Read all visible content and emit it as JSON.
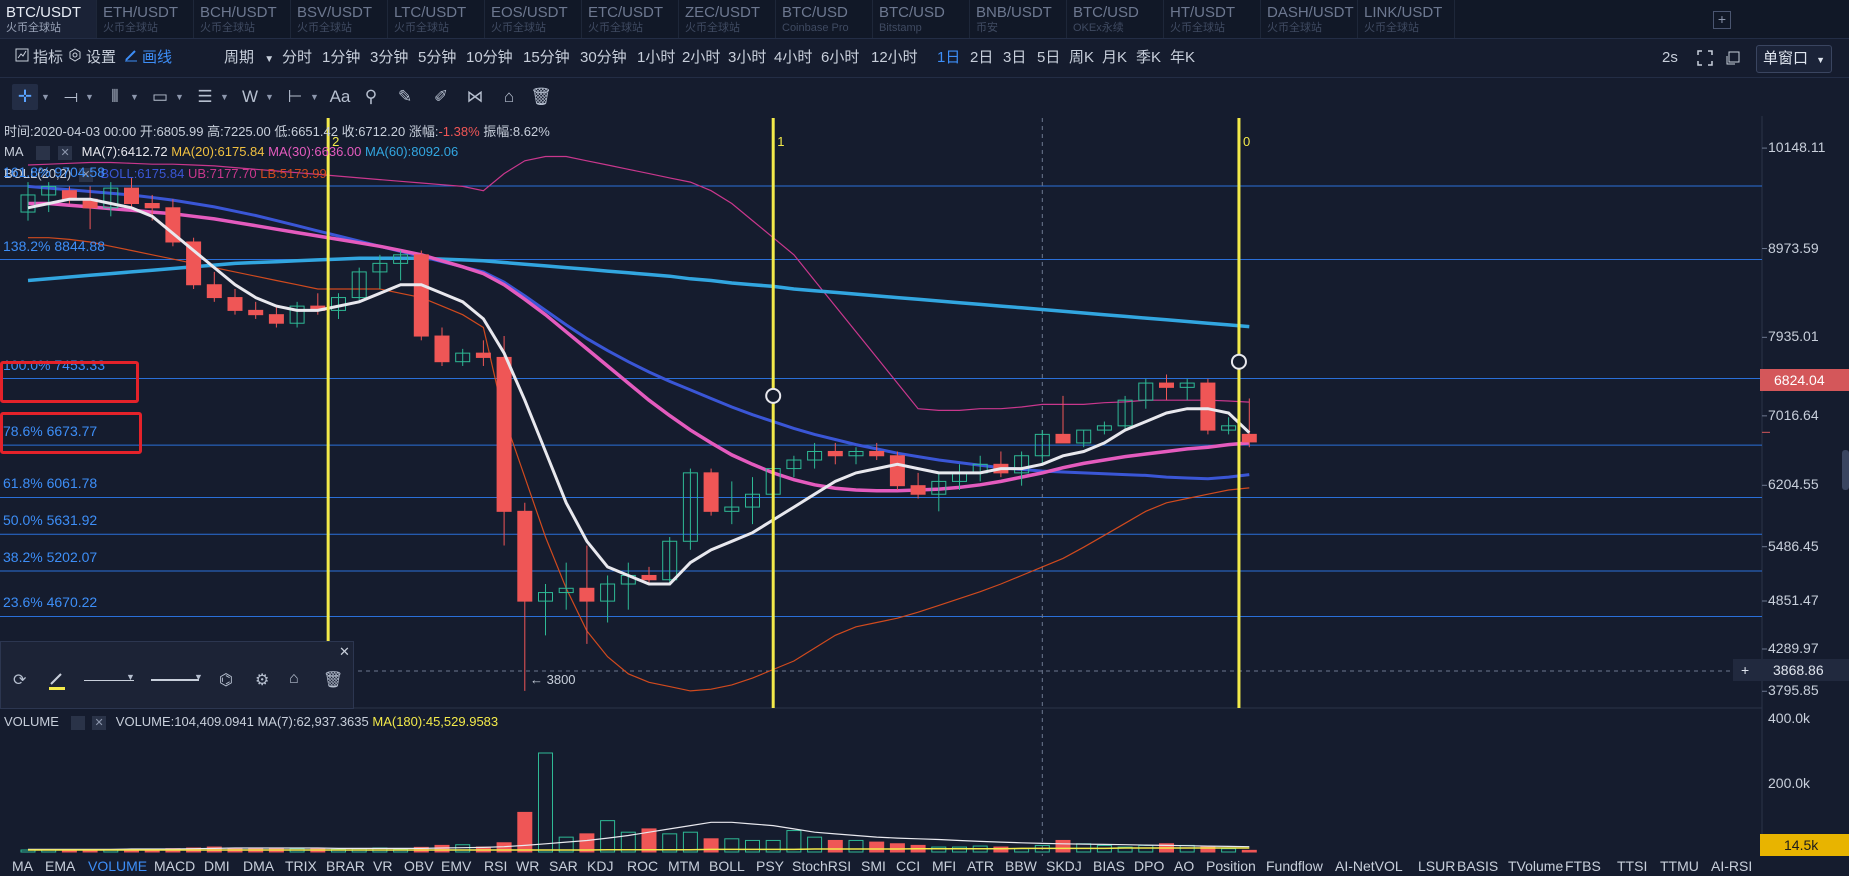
{
  "pair_tabs": [
    {
      "pair": "BTC/USDT",
      "source": "火币全球站"
    },
    {
      "pair": "ETH/USDT",
      "source": "火币全球站"
    },
    {
      "pair": "BCH/USDT",
      "source": "火币全球站"
    },
    {
      "pair": "BSV/USDT",
      "source": "火币全球站"
    },
    {
      "pair": "LTC/USDT",
      "source": "火币全球站"
    },
    {
      "pair": "EOS/USDT",
      "source": "火币全球站"
    },
    {
      "pair": "ETC/USDT",
      "source": "火币全球站"
    },
    {
      "pair": "ZEC/USDT",
      "source": "火币全球站"
    },
    {
      "pair": "BTC/USD",
      "source": "Coinbase Pro"
    },
    {
      "pair": "BTC/USD",
      "source": "Bitstamp"
    },
    {
      "pair": "BNB/USDT",
      "source": "币安"
    },
    {
      "pair": "BTC/USD",
      "source": "OKEx永续"
    },
    {
      "pair": "HT/USDT",
      "source": "火币全球站"
    },
    {
      "pair": "DASH/USDT",
      "source": "火币全球站"
    },
    {
      "pair": "LINK/USDT",
      "source": "火币全球站"
    }
  ],
  "add_tab_label": "+",
  "toolbar": {
    "indicator": "指标",
    "settings": "设置",
    "draw": "画线",
    "period_label": "周期",
    "periods": [
      "分时",
      "1分钟",
      "3分钟",
      "5分钟",
      "10分钟",
      "15分钟",
      "30分钟",
      "1小时",
      "2小时",
      "3小时",
      "4小时",
      "6小时",
      "12小时",
      "1日",
      "2日",
      "3日",
      "5日",
      "周K",
      "月K",
      "季K",
      "年K"
    ],
    "selected_period": "1日",
    "refresh": "2s",
    "window_mode": "单窗口"
  },
  "info": {
    "time": "时间:2020-04-03 00:00",
    "open": "开:6805.99",
    "high": "高:7225.00",
    "low": "低:6651.42",
    "close": "收:6712.20",
    "change_label": "涨幅:",
    "change_value": "-1.38%",
    "amp": "振幅:8.62%"
  },
  "ma_line": {
    "name": "MA",
    "ma7": "MA(7):6412.72",
    "ma20": "MA(20):6175.84",
    "ma30": "MA(30):6636.00",
    "ma60": "MA(60):8092.06"
  },
  "boll_line": {
    "name": "BOLL(20,2)",
    "boll": "BOLL:6175.84",
    "ub": "UB:7177.70",
    "lb": "LB:5173.99"
  },
  "fib_levels": [
    {
      "label": "161.8% 9704.58",
      "price": 9704.58
    },
    {
      "label": "138.2% 8844.88",
      "price": 8844.88
    },
    {
      "label": "100.0% 7453.33",
      "price": 7453.33
    },
    {
      "label": "78.6% 6673.77",
      "price": 6673.77
    },
    {
      "label": "61.8% 6061.78",
      "price": 6061.78
    },
    {
      "label": "50.0% 5631.92",
      "price": 5631.92
    },
    {
      "label": "38.2% 5202.07",
      "price": 5202.07
    },
    {
      "label": "23.6% 4670.22",
      "price": 4670.22
    }
  ],
  "price_axis": [
    "10148.11",
    "8973.59",
    "7935.01",
    "7016.64",
    "6204.55",
    "5486.45",
    "4851.47",
    "4289.97",
    "3795.85"
  ],
  "price_tag": "6824.04",
  "cross_price": "3868.86",
  "cross_plus": "+",
  "min_label": "← 3800",
  "vline_labels": [
    "2",
    "1",
    "0"
  ],
  "chart_data": {
    "type": "candlestick",
    "candles": [
      [
        9400,
        9750,
        9300,
        9600
      ],
      [
        9600,
        9750,
        9400,
        9700
      ],
      [
        9650,
        9700,
        9500,
        9550
      ],
      [
        9550,
        9700,
        9200,
        9450
      ],
      [
        9450,
        9750,
        9350,
        9680
      ],
      [
        9680,
        9800,
        9450,
        9500
      ],
      [
        9500,
        9600,
        9300,
        9450
      ],
      [
        9450,
        9550,
        9000,
        9050
      ],
      [
        9050,
        9100,
        8500,
        8550
      ],
      [
        8550,
        8700,
        8350,
        8400
      ],
      [
        8400,
        8500,
        8200,
        8250
      ],
      [
        8250,
        8350,
        8150,
        8200
      ],
      [
        8200,
        8300,
        8050,
        8100
      ],
      [
        8100,
        8350,
        8050,
        8300
      ],
      [
        8300,
        8450,
        8200,
        8250
      ],
      [
        8250,
        8450,
        8150,
        8400
      ],
      [
        8400,
        8750,
        8350,
        8700
      ],
      [
        8700,
        8900,
        8500,
        8800
      ],
      [
        8800,
        8950,
        8600,
        8900
      ],
      [
        8900,
        8950,
        7900,
        7950
      ],
      [
        7950,
        8050,
        7600,
        7650
      ],
      [
        7650,
        7800,
        7600,
        7750
      ],
      [
        7750,
        7900,
        7600,
        7700
      ],
      [
        7700,
        7950,
        5500,
        5900
      ],
      [
        5900,
        6000,
        3800,
        4850
      ],
      [
        4850,
        5050,
        4450,
        4950
      ],
      [
        4950,
        5300,
        4750,
        5000
      ],
      [
        5000,
        5500,
        4350,
        4850
      ],
      [
        4850,
        5150,
        4600,
        5050
      ],
      [
        5050,
        5300,
        4750,
        5150
      ],
      [
        5150,
        5250,
        5050,
        5100
      ],
      [
        5100,
        5600,
        5050,
        5550
      ],
      [
        5550,
        6400,
        5450,
        6350
      ],
      [
        6350,
        6400,
        5850,
        5900
      ],
      [
        5900,
        6250,
        5750,
        5950
      ],
      [
        5950,
        6300,
        5750,
        6100
      ],
      [
        6100,
        6500,
        6000,
        6400
      ],
      [
        6400,
        6550,
        6300,
        6500
      ],
      [
        6500,
        6700,
        6400,
        6600
      ],
      [
        6600,
        6700,
        6450,
        6550
      ],
      [
        6550,
        6650,
        6450,
        6600
      ],
      [
        6600,
        6700,
        6500,
        6550
      ],
      [
        6550,
        6600,
        6150,
        6200
      ],
      [
        6200,
        6350,
        6050,
        6100
      ],
      [
        6100,
        6350,
        5900,
        6250
      ],
      [
        6250,
        6450,
        6150,
        6350
      ],
      [
        6350,
        6550,
        6250,
        6450
      ],
      [
        6450,
        6600,
        6300,
        6350
      ],
      [
        6350,
        6600,
        6200,
        6550
      ],
      [
        6550,
        6850,
        6450,
        6800
      ],
      [
        6800,
        7250,
        6700,
        6700
      ],
      [
        6700,
        6850,
        6650,
        6850
      ],
      [
        6850,
        6950,
        6800,
        6900
      ],
      [
        6900,
        7250,
        6850,
        7200
      ],
      [
        7200,
        7450,
        7100,
        7400
      ],
      [
        7400,
        7500,
        7200,
        7350
      ],
      [
        7350,
        7450,
        7200,
        7400
      ],
      [
        7400,
        7450,
        6800,
        6850
      ],
      [
        6850,
        7000,
        6800,
        6900
      ],
      [
        6800,
        7220,
        6650,
        6712
      ]
    ],
    "ma7": [
      9450,
      9500,
      9550,
      9550,
      9500,
      9450,
      9350,
      9150,
      8950,
      8750,
      8550,
      8400,
      8300,
      8250,
      8250,
      8300,
      8350,
      8450,
      8550,
      8550,
      8450,
      8350,
      8150,
      7750,
      7200,
      6600,
      6000,
      5550,
      5250,
      5150,
      5050,
      5050,
      5300,
      5450,
      5550,
      5650,
      5800,
      5950,
      6100,
      6250,
      6350,
      6400,
      6450,
      6400,
      6350,
      6350,
      6350,
      6400,
      6400,
      6450,
      6550,
      6600,
      6700,
      6850,
      6950,
      7050,
      7100,
      7100,
      7050,
      6820
    ],
    "ma30": [
      9700,
      9680,
      9660,
      9640,
      9620,
      9600,
      9570,
      9540,
      9500,
      9460,
      9410,
      9360,
      9300,
      9240,
      9180,
      9120,
      9060,
      9000,
      8940,
      8880,
      8820,
      8760,
      8700,
      8580,
      8420,
      8250,
      8080,
      7920,
      7780,
      7650,
      7530,
      7420,
      7320,
      7220,
      7120,
      7030,
      6950,
      6870,
      6800,
      6740,
      6680,
      6630,
      6580,
      6540,
      6500,
      6470,
      6440,
      6410,
      6390,
      6370,
      6360,
      6350,
      6340,
      6330,
      6320,
      6300,
      6290,
      6280,
      6300,
      6330
    ],
    "ma20": [
      9500,
      9500,
      9480,
      9460,
      9440,
      9420,
      9400,
      9380,
      9350,
      9320,
      9280,
      9240,
      9200,
      9160,
      9120,
      9080,
      9040,
      9000,
      8950,
      8900,
      8830,
      8760,
      8680,
      8550,
      8380,
      8200,
      8000,
      7800,
      7600,
      7400,
      7200,
      7020,
      6850,
      6700,
      6560,
      6450,
      6350,
      6270,
      6210,
      6170,
      6150,
      6140,
      6140,
      6150,
      6160,
      6180,
      6210,
      6250,
      6300,
      6350,
      6410,
      6460,
      6500,
      6540,
      6570,
      6600,
      6630,
      6650,
      6680,
      6700
    ],
    "ma60": [
      8600,
      8620,
      8640,
      8660,
      8680,
      8700,
      8720,
      8740,
      8760,
      8780,
      8800,
      8810,
      8820,
      8830,
      8840,
      8850,
      8860,
      8860,
      8860,
      8860,
      8850,
      8840,
      8830,
      8810,
      8790,
      8770,
      8750,
      8730,
      8710,
      8690,
      8670,
      8650,
      8620,
      8600,
      8570,
      8550,
      8530,
      8500,
      8480,
      8460,
      8440,
      8420,
      8400,
      8380,
      8360,
      8340,
      8320,
      8300,
      8280,
      8260,
      8240,
      8220,
      8200,
      8180,
      8160,
      8140,
      8120,
      8100,
      8080,
      8060
    ],
    "ub": [
      9950,
      9960,
      9970,
      9980,
      9980,
      9970,
      9960,
      9960,
      9950,
      9940,
      9920,
      9900,
      9880,
      9860,
      9840,
      9820,
      9800,
      9780,
      9760,
      9740,
      9720,
      9700,
      9650,
      9850,
      10000,
      10050,
      10050,
      10000,
      9950,
      9900,
      9850,
      9800,
      9750,
      9650,
      9500,
      9300,
      9100,
      8900,
      8600,
      8300,
      8000,
      7700,
      7400,
      7100,
      7080,
      7080,
      7100,
      7100,
      7120,
      7150,
      7150,
      7150,
      7170,
      7180,
      7200,
      7200,
      7200,
      7200,
      7190,
      7178
    ],
    "lb": [
      9100,
      9100,
      9080,
      9050,
      9000,
      8950,
      8900,
      8850,
      8800,
      8750,
      8700,
      8650,
      8600,
      8550,
      8500,
      8500,
      8500,
      8500,
      8450,
      8400,
      8300,
      8200,
      8050,
      7000,
      6300,
      5600,
      5000,
      4500,
      4200,
      4000,
      3900,
      3850,
      3800,
      3820,
      3870,
      3950,
      4050,
      4150,
      4300,
      4450,
      4550,
      4600,
      4650,
      4720,
      4800,
      4880,
      4960,
      5050,
      5150,
      5250,
      5350,
      5480,
      5620,
      5760,
      5900,
      6000,
      6050,
      6100,
      6150,
      6174
    ],
    "volume": [
      6,
      6,
      5,
      5,
      6,
      8,
      7,
      10,
      12,
      15,
      12,
      10,
      10,
      10,
      9,
      8,
      10,
      12,
      9,
      14,
      20,
      22,
      15,
      28,
      120,
      300,
      45,
      55,
      95,
      60,
      70,
      55,
      60,
      40,
      40,
      35,
      35,
      65,
      45,
      35,
      35,
      30,
      25,
      20,
      15,
      15,
      18,
      15,
      10,
      20,
      35,
      25,
      20,
      15,
      20,
      25,
      20,
      15,
      10,
      5
    ],
    "vol_ma7": [
      8,
      8,
      8,
      8,
      8,
      9,
      9,
      9,
      10,
      11,
      12,
      12,
      12,
      12,
      12,
      11,
      11,
      11,
      11,
      11,
      12,
      13,
      14,
      16,
      20,
      25,
      30,
      35,
      42,
      50,
      60,
      70,
      80,
      90,
      90,
      85,
      80,
      70,
      60,
      55,
      50,
      45,
      42,
      40,
      38,
      35,
      32,
      30,
      28,
      26,
      25,
      24,
      23,
      22,
      21,
      20,
      19,
      18,
      17,
      16
    ],
    "vol_ma180": [
      6,
      6,
      6,
      6,
      6,
      6,
      6,
      6,
      6,
      6,
      6,
      6,
      6,
      6,
      6,
      6,
      6,
      6,
      6,
      6,
      6,
      6,
      6,
      6,
      6,
      6,
      6,
      6,
      7,
      7,
      7,
      7,
      7,
      8,
      8,
      8,
      8,
      8,
      9,
      9,
      9,
      9,
      9,
      10,
      10,
      10,
      10,
      10,
      11,
      11,
      11,
      11,
      11,
      12,
      12,
      12,
      12,
      12,
      12,
      12
    ],
    "price_axis_range": [
      3600,
      10500
    ],
    "volume_axis": [
      "400.0k",
      "200.0k"
    ],
    "volume_tag": "14.5k",
    "vertical_lines": [
      {
        "label": "2",
        "index": 14.5
      },
      {
        "label": "1",
        "index": 36
      },
      {
        "label": "0",
        "index": 58.5
      }
    ],
    "circle_markers": [
      {
        "index": 36,
        "price": 7250
      },
      {
        "index": 58.5,
        "price": 7650
      }
    ],
    "crosshair_index": 49
  },
  "volume_info": {
    "name": "VOLUME",
    "volume": "VOLUME:104,409.0941",
    "ma7": "MA(7):62,937.3635",
    "ma180": "MA(180):45,529.9583"
  },
  "colors": {
    "up": "#2eb995",
    "down": "#ef5656",
    "ma7": "#e8e8ee",
    "ma20": "#e45bbe",
    "ma30": "#3a56d6",
    "ma60": "#32a6e0",
    "ub": "#c9378d",
    "lb": "#d04a1e",
    "fib": "#2a6fd8",
    "vline": "#f3ea4a",
    "accent": "#3d8ef7"
  },
  "indicators": [
    "MA",
    "EMA",
    "VOLUME",
    "MACD",
    "DMI",
    "DMA",
    "TRIX",
    "BRAR",
    "VR",
    "OBV",
    "EMV",
    "RSI",
    "WR",
    "SAR",
    "KDJ",
    "ROC",
    "MTM",
    "BOLL",
    "PSY",
    "StochRSI",
    "SMI",
    "CCI",
    "MFI",
    "ATR",
    "BBW",
    "SKDJ",
    "BIAS",
    "DPO",
    "AO",
    "Position",
    "Fundflow",
    "AI-NetVOL",
    "LSUR",
    "BASIS",
    "TVolume",
    "FTBS",
    "TTSI",
    "TTMU",
    "AI-RSI"
  ],
  "selected_indicator": "VOLUME"
}
